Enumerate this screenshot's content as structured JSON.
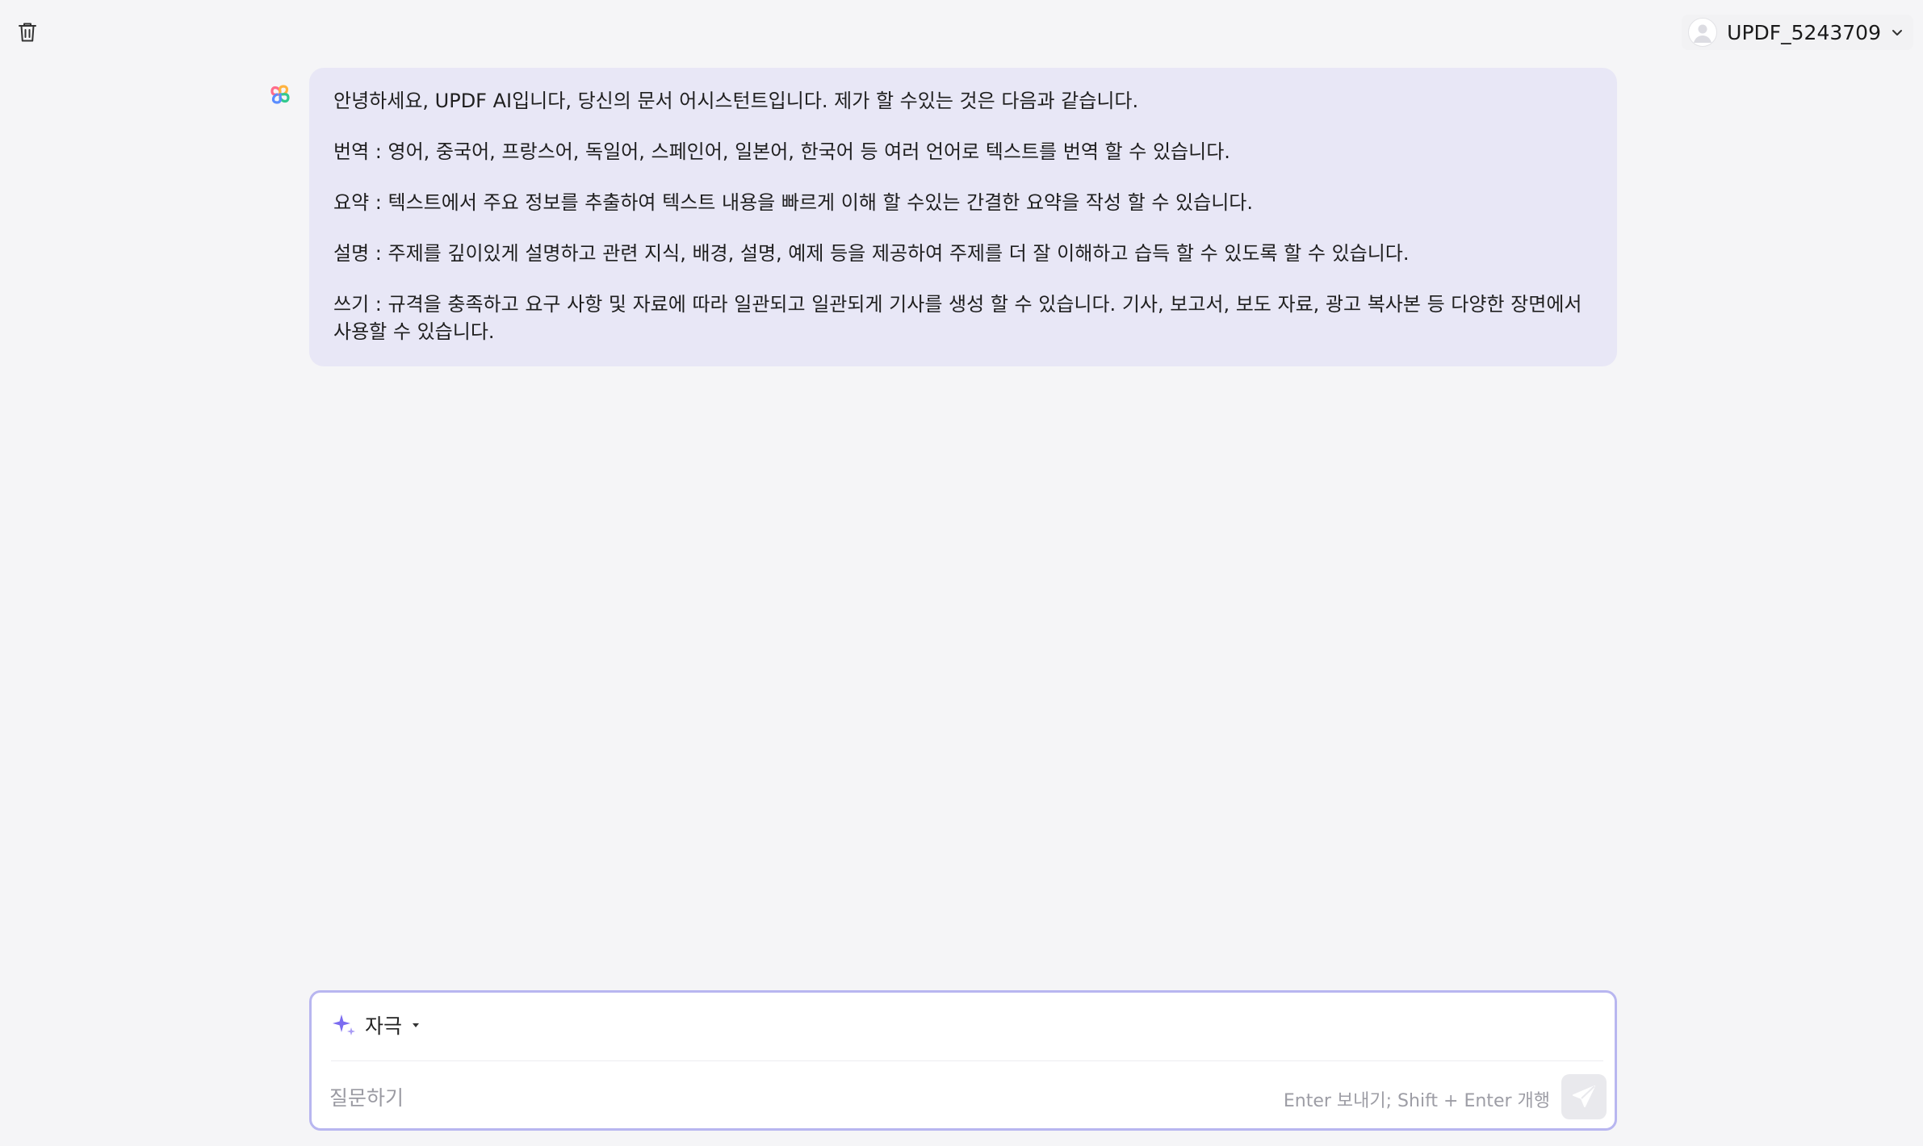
{
  "user": {
    "name": "UPDF_5243709"
  },
  "conversation": {
    "messages": [
      {
        "role": "assistant",
        "paragraphs": [
          "안녕하세요, UPDF AI입니다, 당신의 문서 어시스턴트입니다. 제가 할 수있는 것은 다음과 같습니다.",
          "번역 : 영어, 중국어, 프랑스어, 독일어, 스페인어, 일본어, 한국어 등 여러 언어로 텍스트를 번역 할 수 있습니다.",
          "요약 : 텍스트에서 주요 정보를 추출하여 텍스트 내용을 빠르게 이해 할 수있는 간결한 요약을 작성 할 수 있습니다.",
          "설명 : 주제를 깊이있게 설명하고 관련 지식, 배경, 설명, 예제 등을 제공하여 주제를 더 잘 이해하고 습득 할 수 있도록 할 수 있습니다.",
          "쓰기 : 규격을 충족하고 요구 사항 및 자료에 따라 일관되고 일관되게 기사를 생성 할 수 있습니다. 기사, 보고서, 보도 자료, 광고 복사본 등 다양한 장면에서 사용할 수 있습니다."
        ]
      }
    ]
  },
  "composer": {
    "mode_label": "자극",
    "placeholder": "질문하기",
    "value": "",
    "hint": "Enter 보내기; Shift + Enter 개행"
  },
  "icons": {
    "trash": "trash-icon",
    "avatar": "user-avatar-icon",
    "dropdown": "chevron-down-icon",
    "logo": "updf-ai-logo-icon",
    "sparkle": "sparkle-icon",
    "caret": "caret-down-icon",
    "send": "send-icon"
  },
  "colors": {
    "accent": "#7b6cf0",
    "bubble": "#e8e7f6",
    "composer_border": "#b8b6f0"
  }
}
